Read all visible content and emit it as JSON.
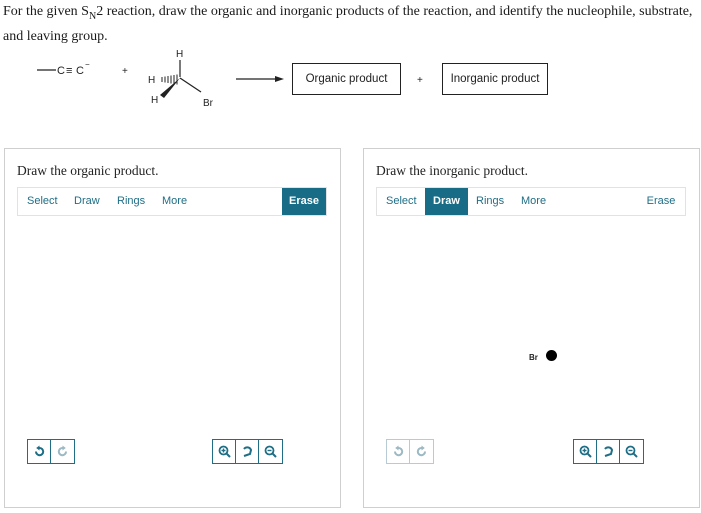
{
  "prompt": {
    "before_sub": "For the given S",
    "sub": "N",
    "after_sub": "2 reaction, draw the organic and inorganic products of the reaction, and identify the nucleophile, substrate, and leaving group."
  },
  "scheme": {
    "nucleophile_c1": "C",
    "triple_bond": "≡",
    "nucleophile_c2": "C",
    "charge": "−",
    "plus_1": "+",
    "atom_h_top": "H",
    "atom_h_left": "H",
    "atom_h_bottom": "H",
    "atom_br": "Br",
    "organic_product": "Organic product",
    "plus_2": "+",
    "inorganic_product": "Inorganic product"
  },
  "left_panel": {
    "title": "Draw the organic product.",
    "tools": [
      "Select",
      "Draw",
      "Rings",
      "More"
    ],
    "erase": "Erase"
  },
  "right_panel": {
    "title": "Draw the inorganic product.",
    "tools": [
      "Select",
      "Draw",
      "Rings",
      "More"
    ],
    "active_tool": "Draw",
    "erase": "Erase",
    "atom_label": "Br"
  },
  "icons": {
    "undo": "undo-icon",
    "redo": "redo-icon",
    "zoom_in": "zoom-in-icon",
    "reset": "reset-view-icon",
    "zoom_out": "zoom-out-icon"
  },
  "colors": {
    "accent": "#186c86",
    "link": "#1f6e86"
  }
}
